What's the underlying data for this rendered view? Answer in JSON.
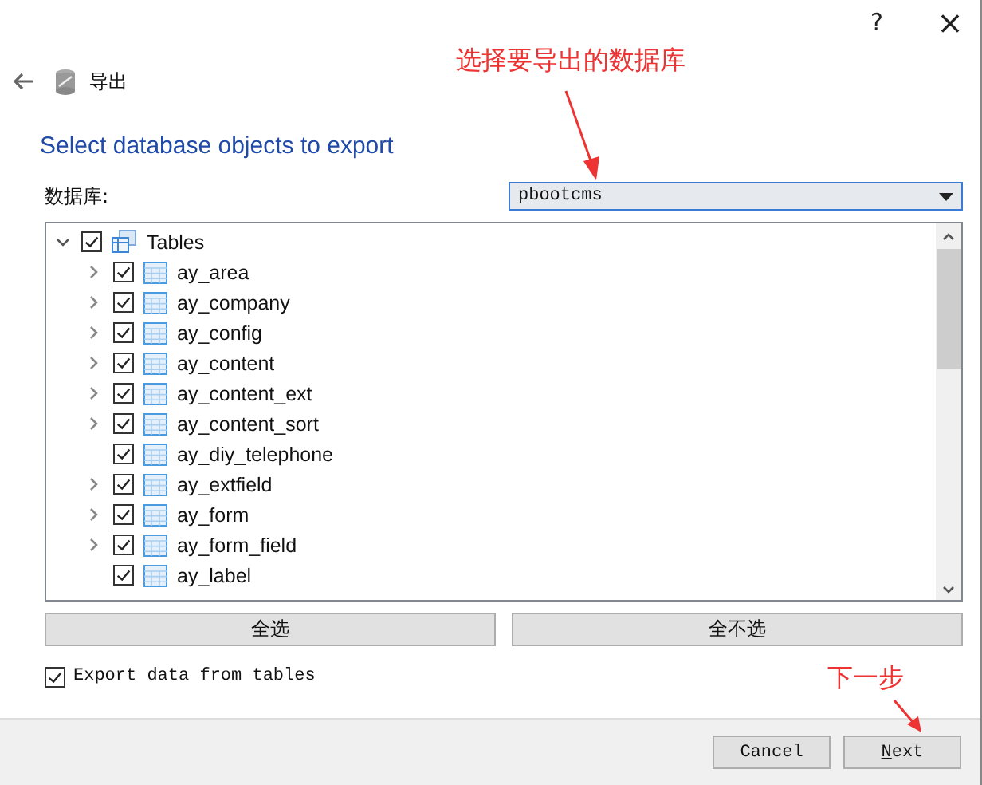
{
  "window": {
    "help": "?",
    "close": "×"
  },
  "header": {
    "title": "导出"
  },
  "heading": "Select database objects to export",
  "database": {
    "label": "数据库:",
    "value": "pbootcms"
  },
  "tree": {
    "label": "Tables",
    "expanded": true,
    "checked": true,
    "children": [
      {
        "label": "ay_area",
        "kind": "expandable",
        "checked": true
      },
      {
        "label": "ay_company",
        "kind": "expandable",
        "checked": true
      },
      {
        "label": "ay_config",
        "kind": "expandable",
        "checked": true
      },
      {
        "label": "ay_content",
        "kind": "expandable",
        "checked": true
      },
      {
        "label": "ay_content_ext",
        "kind": "expandable",
        "checked": true
      },
      {
        "label": "ay_content_sort",
        "kind": "expandable",
        "checked": true
      },
      {
        "label": "ay_diy_telephone",
        "kind": "leaf",
        "checked": true
      },
      {
        "label": "ay_extfield",
        "kind": "expandable",
        "checked": true
      },
      {
        "label": "ay_form",
        "kind": "expandable",
        "checked": true
      },
      {
        "label": "ay_form_field",
        "kind": "expandable",
        "checked": true
      },
      {
        "label": "ay_label",
        "kind": "leaf",
        "checked": true
      }
    ]
  },
  "select_buttons": [
    "全选",
    "全不选"
  ],
  "export_data": {
    "label": "Export data from tables",
    "checked": true
  },
  "footer_buttons": [
    {
      "label": "Cancel",
      "kind": "plain"
    },
    {
      "label": "Next",
      "kind": "mnemonic"
    }
  ],
  "annotations": [
    {
      "text": "选择要导出的数据库"
    },
    {
      "text": "下一步"
    }
  ]
}
